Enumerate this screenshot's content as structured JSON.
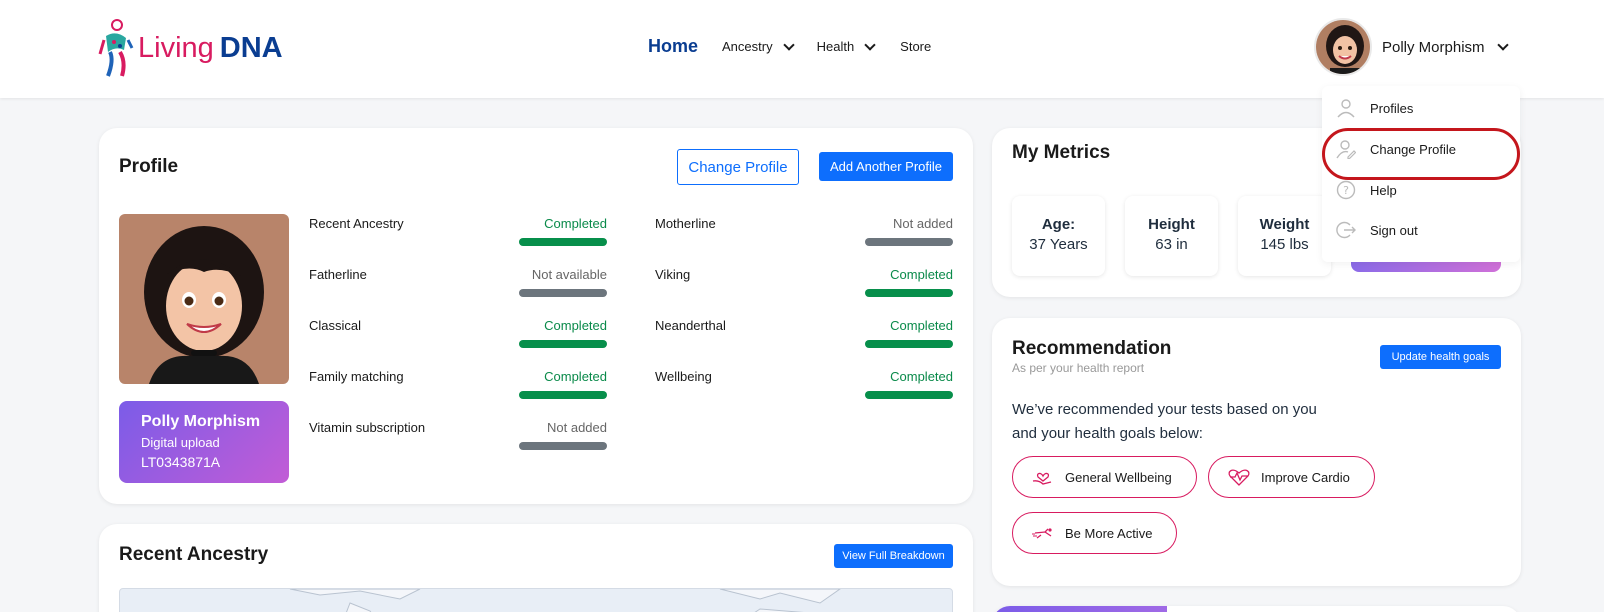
{
  "brand": {
    "name_part1": "Living",
    "name_part2": "DNA"
  },
  "nav": {
    "home": "Home",
    "ancestry": "Ancestry",
    "health": "Health",
    "store": "Store"
  },
  "user": {
    "name": "Polly Morphism"
  },
  "dropdown": {
    "items": [
      {
        "label": "Profiles",
        "icon": "user-icon"
      },
      {
        "label": "Change Profile",
        "icon": "user-edit-icon"
      },
      {
        "label": "Help",
        "icon": "help-icon"
      },
      {
        "label": "Sign out",
        "icon": "sign-out-icon"
      }
    ]
  },
  "profile": {
    "title": "Profile",
    "change_btn": "Change Profile",
    "add_btn": "Add Another Profile",
    "badge_name": "Polly Morphism",
    "badge_sub": "Digital upload",
    "badge_id": "LT0343871A",
    "tests_left": [
      {
        "label": "Recent Ancestry",
        "status": "Completed"
      },
      {
        "label": "Fatherline",
        "status": "Not available"
      },
      {
        "label": "Classical",
        "status": "Completed"
      },
      {
        "label": "Family matching",
        "status": "Completed"
      },
      {
        "label": "Vitamin subscription",
        "status": "Not added"
      }
    ],
    "tests_right": [
      {
        "label": "Motherline",
        "status": "Not added"
      },
      {
        "label": "Viking",
        "status": "Completed"
      },
      {
        "label": "Neanderthal",
        "status": "Completed"
      },
      {
        "label": "Wellbeing",
        "status": "Completed"
      }
    ]
  },
  "metrics": {
    "title": "My Metrics",
    "items": [
      {
        "label": "Age:",
        "value": "37 Years"
      },
      {
        "label": "Height",
        "value": "63 in"
      },
      {
        "label": "Weight",
        "value": "145 lbs"
      }
    ]
  },
  "recommendation": {
    "title": "Recommendation",
    "subtitle": "As per your health report",
    "update_btn": "Update health goals",
    "text": "We’ve recommended your tests based on you and your health goals below:",
    "goals": [
      {
        "label": "General Wellbeing",
        "icon": "heart-hand-icon"
      },
      {
        "label": "Improve Cardio",
        "icon": "heartbeat-icon"
      },
      {
        "label": "Be More Active",
        "icon": "running-icon"
      }
    ]
  },
  "recent_ancestry": {
    "title": "Recent Ancestry",
    "view_btn": "View Full Breakdown"
  },
  "colors": {
    "accent": "#0d6efd",
    "brand_pink": "#d81b60",
    "brand_blue": "#0a3d91",
    "completed": "#078f4b",
    "not_available": "#6c757d",
    "highlight": "#c4161c"
  }
}
